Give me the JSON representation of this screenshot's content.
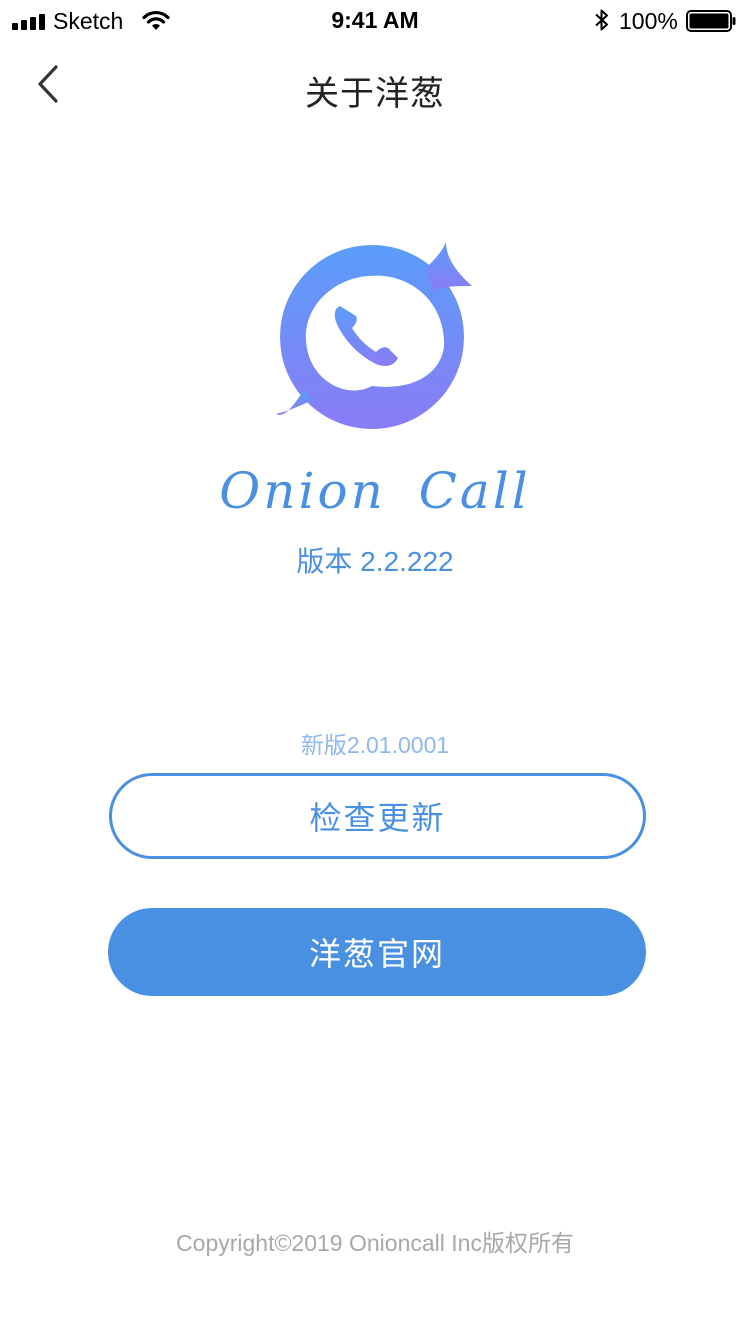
{
  "status_bar": {
    "carrier": "Sketch",
    "time": "9:41 AM",
    "battery_percent": "100%",
    "battery_level": 1.0,
    "icons": [
      "signal-icon",
      "wifi-icon",
      "bluetooth-icon",
      "battery-icon"
    ]
  },
  "nav": {
    "back_icon": "chevron-left-icon",
    "title": "关于洋葱"
  },
  "about": {
    "logo_icon": "phone-bubble-logo-icon",
    "app_name": "Onion  Call",
    "version": "版本 2.2.222"
  },
  "update": {
    "new_version": "新版2.01.0001",
    "check_button": "检查更新",
    "website_button": "洋葱官网"
  },
  "footer": {
    "copyright": "Copyright©2019 Onioncall Inc版权所有"
  },
  "colors": {
    "accent": "#4a90e2",
    "logo_top": "#5b9dfa",
    "logo_bottom": "#8a7cf5",
    "muted_text": "#a8a8a8",
    "new_version_text": "#8fb8f0"
  }
}
